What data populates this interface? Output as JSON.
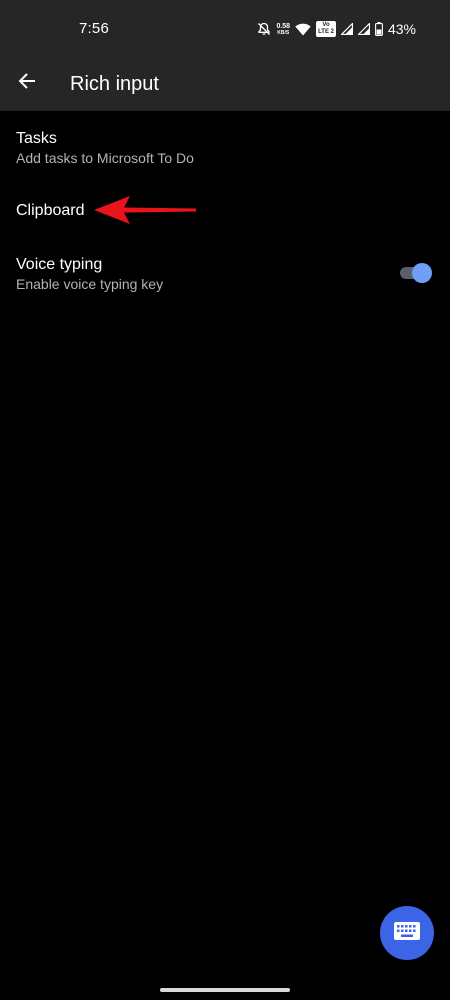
{
  "status_bar": {
    "time": "7:56",
    "net_speed_value": "0.58",
    "net_speed_unit": "KB/S",
    "volte_top": "Vo",
    "volte_bottom": "LTE 2",
    "battery_percent": "43%",
    "icons": [
      "bell-off-icon",
      "wifi-icon",
      "volte-icon",
      "signal-icon",
      "signal-icon",
      "battery-icon"
    ]
  },
  "app_bar": {
    "title": "Rich input",
    "back_icon": "arrow-left-icon"
  },
  "settings": {
    "items": [
      {
        "title": "Tasks",
        "subtitle": "Add tasks to Microsoft To Do"
      },
      {
        "title": "Clipboard"
      },
      {
        "title": "Voice typing",
        "subtitle": "Enable voice typing key",
        "toggle_on": true
      }
    ]
  },
  "annotation": {
    "color": "#e8131b",
    "icon": "arrow-left-icon"
  },
  "fab": {
    "icon": "keyboard-icon",
    "color": "#3c64e6"
  },
  "colors": {
    "background": "#000000",
    "bar": "#262626",
    "subtitle": "#b3b3b3",
    "toggle_thumb": "#6ea0f5",
    "toggle_track": "#5a5f6a"
  }
}
